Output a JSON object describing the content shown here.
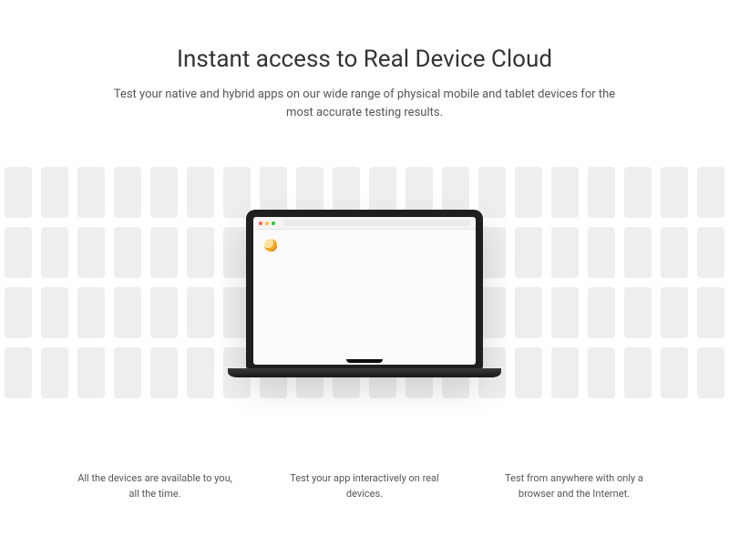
{
  "hero": {
    "title": "Instant access to Real Device Cloud",
    "subtitle": "Test your native and hybrid apps on our wide range of physical mobile and tablet devices for the most accurate testing results."
  },
  "features": [
    {
      "text": "All the devices are available to you, all the time."
    },
    {
      "text": "Test your app interactively on real devices."
    },
    {
      "text": "Test from anywhere with only a browser and the Internet."
    }
  ]
}
